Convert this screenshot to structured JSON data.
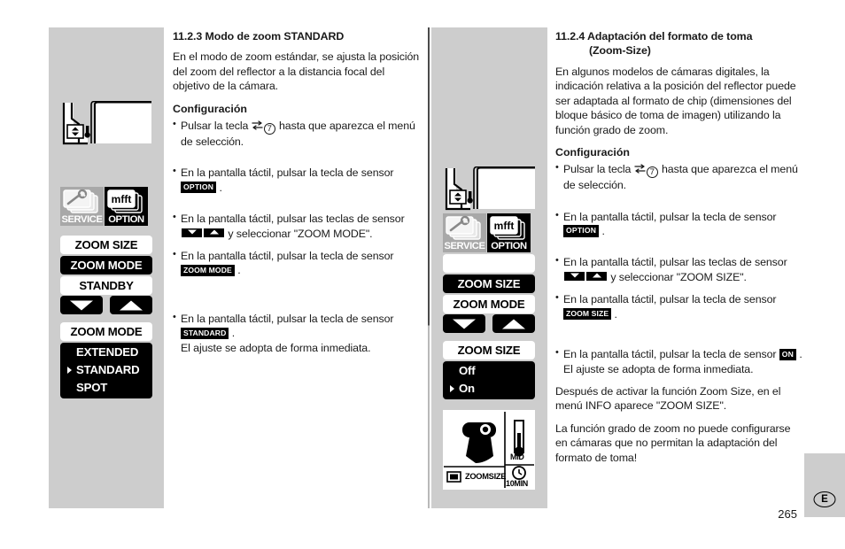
{
  "page": {
    "number": "265",
    "language_badge": "E"
  },
  "left_section": {
    "heading": "11.2.3 Modo de zoom STANDARD",
    "intro": "En el modo de zoom estándar, se ajusta la posición del zoom del reflector a la distancia focal del objetivo de la cámara.",
    "config_label": "Configuración",
    "steps": [
      {
        "pre": "Pulsar la tecla ",
        "icon": "swap-icon",
        "num": "7",
        "post": " hasta que aparezca el menú de selección."
      },
      {
        "pre": "En la pantalla táctil, pulsar la tecla de sensor ",
        "key": "OPTION",
        "post": " ."
      },
      {
        "pre": "En la pantalla táctil, pulsar las teclas de sensor ",
        "arrows": [
          "down-arrow-key",
          "up-arrow-key"
        ],
        "post": " y seleccionar \"ZOOM MODE\"."
      },
      {
        "pre": "En la pantalla táctil, pulsar la tecla de sensor ",
        "key": "ZOOM MODE",
        "post": " ."
      },
      {
        "pre": "En la pantalla táctil, pulsar la tecla de sensor ",
        "key": "STANDARD",
        "post": " .",
        "extra": "El ajuste se adopta de forma inmediata."
      }
    ]
  },
  "right_section": {
    "heading_line1": "11.2.4 Adaptación del formato de toma",
    "heading_line2": "(Zoom-Size)",
    "intro": "En algunos modelos de cámaras digitales, la indicación relativa a la posición del reflector puede ser adaptada al formato de chip (dimensiones del bloque básico de toma de imagen) utilizando la función grado de zoom.",
    "config_label": "Configuración",
    "steps": [
      {
        "pre": "Pulsar la tecla ",
        "icon": "swap-icon",
        "num": "7",
        "post": " hasta que aparezca el menú de selección."
      },
      {
        "pre": "En la pantalla táctil, pulsar la tecla de sensor ",
        "key": "OPTION",
        "post": " ."
      },
      {
        "pre": "En la pantalla táctil, pulsar las teclas de sensor ",
        "arrows": [
          "down-arrow-key",
          "up-arrow-key"
        ],
        "post": " y seleccionar \"ZOOM SIZE\"."
      },
      {
        "pre": "En la pantalla táctil, pulsar la tecla de sensor ",
        "key": "ZOOM SIZE",
        "post": " ."
      },
      {
        "pre": "En la pantalla táctil, pulsar la tecla de sensor ",
        "key": "ON",
        "post": " . El ajuste se adopta de forma inmediata."
      }
    ],
    "note1": "Después de activar la función Zoom Size, en el menú INFO aparece \"ZOOM SIZE\".",
    "note2": "La función grado de zoom no puede configurarse en cámaras que no permitan la adaptación del formato de toma!"
  },
  "left_graphics": {
    "tiles": [
      {
        "label": "SERVICE",
        "icon": "wrench-cards-icon",
        "state": "inactive"
      },
      {
        "label": "OPTION",
        "icon": "mft-cards-icon",
        "state": "active"
      }
    ],
    "menu_rows": [
      {
        "label": "ZOOM SIZE",
        "style": "white"
      },
      {
        "label": "ZOOM MODE",
        "style": "black"
      },
      {
        "label": "STANDBY",
        "style": "white"
      }
    ],
    "arrow_keys": [
      "down-arrow-key",
      "up-arrow-key"
    ],
    "submenu": {
      "title": "ZOOM MODE",
      "options": [
        {
          "label": "EXTENDED",
          "selected": false
        },
        {
          "label": "STANDARD",
          "selected": true
        },
        {
          "label": "SPOT",
          "selected": false
        }
      ]
    }
  },
  "mid_graphics": {
    "tiles": [
      {
        "label": "SERVICE",
        "icon": "wrench-cards-icon",
        "state": "inactive"
      },
      {
        "label": "OPTION",
        "icon": "mft-cards-icon",
        "state": "active"
      }
    ],
    "menu_rows": [
      {
        "label": "",
        "style": "blank"
      },
      {
        "label": "ZOOM SIZE",
        "style": "black"
      },
      {
        "label": "ZOOM MODE",
        "style": "white"
      }
    ],
    "arrow_keys": [
      "down-arrow-key",
      "up-arrow-key"
    ],
    "submenu": {
      "title": "ZOOM SIZE",
      "options": [
        {
          "label": "Off",
          "selected": false
        },
        {
          "label": "On",
          "selected": true
        }
      ]
    },
    "info_screen": {
      "flash_icon": "flash-unit-icon",
      "zoomsize_label": "ZOOMSIZE",
      "zoomsize_icon": "rectangle-icon",
      "battery_label": "MID",
      "battery_icon": "thermometer-icon",
      "timer_label": "10MIN",
      "timer_icon": "clock-icon"
    }
  }
}
